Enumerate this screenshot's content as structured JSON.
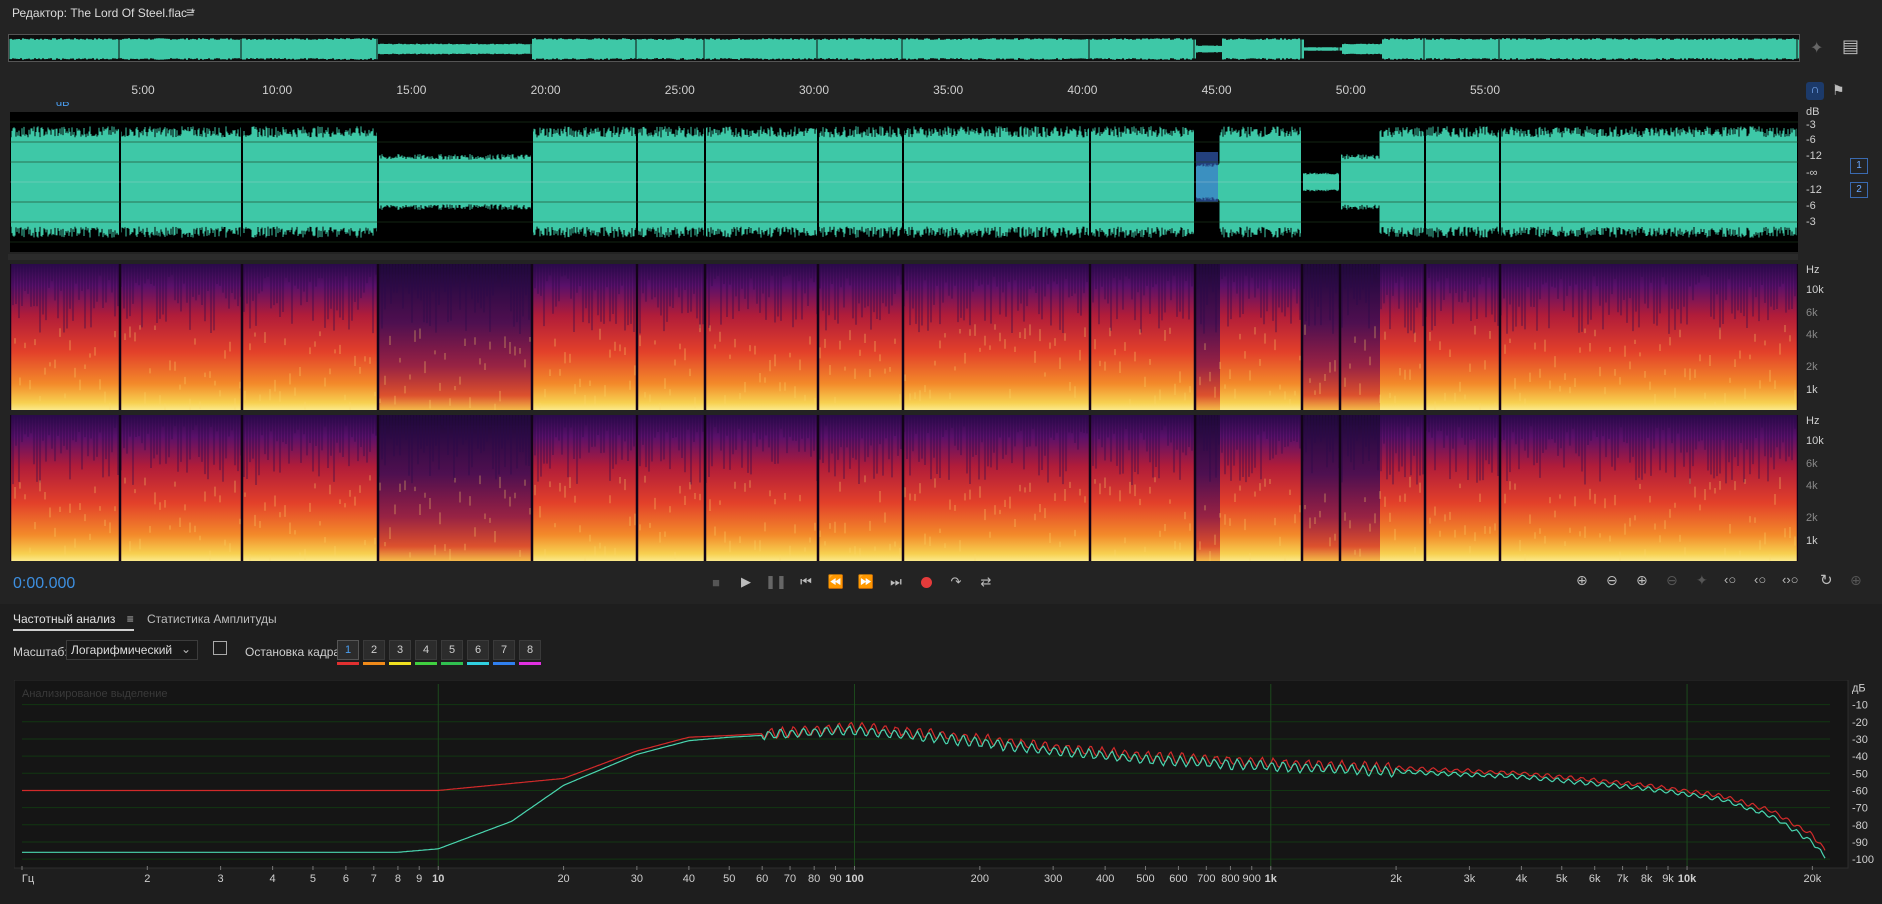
{
  "window": {
    "title": "Редактор: The Lord Of Steel.flac *",
    "menu_icon": "hamburger-icon"
  },
  "ruler": {
    "labels": [
      "5:00",
      "10:00",
      "15:00",
      "20:00",
      "25:00",
      "30:00",
      "35:00",
      "40:00",
      "45:00",
      "50:00",
      "55:00"
    ],
    "gain": "+0 dB"
  },
  "waveform": {
    "db_labels": [
      "dB",
      "-3",
      "-6",
      "-12",
      "-∞",
      "-12",
      "-6",
      "-3"
    ],
    "channels": [
      "1",
      "2"
    ],
    "color": "#3ec8a7"
  },
  "spectrogram": {
    "hz_labels": [
      "Hz",
      "10k",
      "6k",
      "4k",
      "2k",
      "1k"
    ]
  },
  "transport": {
    "timecode": "0:00.000",
    "buttons": [
      "stop",
      "play",
      "pause",
      "go-to-start",
      "rewind",
      "fast-forward",
      "go-to-end",
      "record",
      "loop",
      "skip-selection"
    ]
  },
  "panel": {
    "tabs": [
      "Частотный анализ",
      "Статистика Амплитуды"
    ],
    "scale_label": "Масштаб:",
    "scale_value": "Логарифмический",
    "frame_label": "Остановка кадра:",
    "frames": [
      "1",
      "2",
      "3",
      "4",
      "5",
      "6",
      "7",
      "8"
    ],
    "frame_colors": [
      "#e23030",
      "#f08a1a",
      "#f0e020",
      "#40d040",
      "#30c050",
      "#30d0e0",
      "#3080f0",
      "#e030e0"
    ],
    "analyzed_label": "Анализированое выделение"
  },
  "chart_data": {
    "type": "line",
    "title": "",
    "xlabel": "Гц",
    "ylabel": "дБ",
    "x_scale": "log",
    "x_ticks": [
      "Гц",
      "2",
      "3",
      "4",
      "5",
      "6",
      "7",
      "8",
      "9",
      "10",
      "20",
      "30",
      "40",
      "50",
      "60",
      "70",
      "80",
      "90",
      "100",
      "200",
      "300",
      "400",
      "500",
      "600",
      "700",
      "800",
      "900",
      "1k",
      "2k",
      "3k",
      "4k",
      "5k",
      "6k",
      "7k",
      "8k",
      "9k",
      "10k",
      "20k"
    ],
    "x_tick_values": [
      1,
      2,
      3,
      4,
      5,
      6,
      7,
      8,
      9,
      10,
      20,
      30,
      40,
      50,
      60,
      70,
      80,
      90,
      100,
      200,
      300,
      400,
      500,
      600,
      700,
      800,
      900,
      1000,
      2000,
      3000,
      4000,
      5000,
      6000,
      7000,
      8000,
      9000,
      10000,
      20000
    ],
    "bold_ticks": [
      "10",
      "100",
      "1k",
      "10k"
    ],
    "y_ticks": [
      "дБ",
      "-10",
      "-20",
      "-30",
      "-40",
      "-50",
      "-60",
      "-70",
      "-80",
      "-90",
      "-100"
    ],
    "y_tick_values": [
      0,
      -10,
      -20,
      -30,
      -40,
      -50,
      -60,
      -70,
      -80,
      -90,
      -100
    ],
    "ylim": [
      -104,
      2
    ],
    "xlim": [
      1,
      22050
    ],
    "series": [
      {
        "color": "#d22a2a",
        "x": [
          1,
          10,
          20,
          30,
          40,
          50,
          70,
          90,
          100,
          150,
          200,
          300,
          500,
          1000,
          2000,
          4000,
          8000,
          12000,
          16000,
          20000,
          21500
        ],
        "values": [
          -60,
          -60,
          -53,
          -37,
          -29,
          -28,
          -26,
          -24,
          -23,
          -27,
          -30,
          -35,
          -40,
          -44,
          -47,
          -50,
          -57,
          -63,
          -72,
          -86,
          -95
        ]
      },
      {
        "color": "#4ad6b0",
        "x": [
          1,
          8,
          10,
          15,
          20,
          30,
          40,
          50,
          70,
          90,
          100,
          150,
          200,
          300,
          500,
          1000,
          2000,
          4000,
          8000,
          12000,
          16000,
          20000,
          21500
        ],
        "values": [
          -96,
          -96,
          -94,
          -78,
          -57,
          -39,
          -31,
          -29,
          -27,
          -25,
          -25,
          -29,
          -32,
          -37,
          -42,
          -46,
          -49,
          -52,
          -59,
          -65,
          -75,
          -90,
          -99
        ]
      }
    ]
  }
}
